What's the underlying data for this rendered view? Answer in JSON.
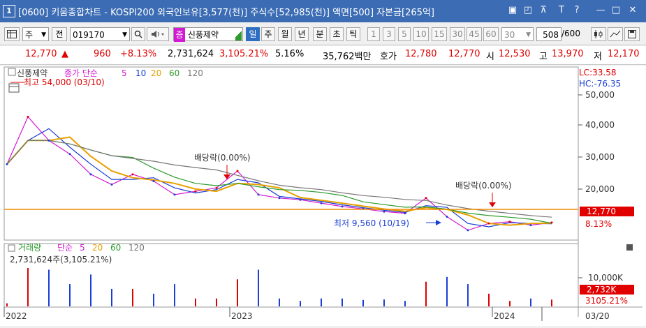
{
  "window": {
    "number": "1",
    "title": "[0600] 키움종합차트 - KOSPI200 외국인보유[3,577(천)] 주식수[52,985(천)] 액면[500] 자본금[265억]",
    "buttons": [
      "▣",
      "◰",
      "⊼",
      "T",
      "?",
      "—",
      "□",
      "✕"
    ]
  },
  "toolbar": {
    "market_type": "주",
    "period_label": "전",
    "stock_code": "019170",
    "stock_badge": "증",
    "stock_name": "신풍제약",
    "period_tabs": [
      "일",
      "주",
      "월",
      "년"
    ],
    "period_selected": "일",
    "interval_tabs": [
      "분",
      "초",
      "틱"
    ],
    "minute_values": [
      "1",
      "3",
      "5",
      "10",
      "15",
      "30",
      "45",
      "60"
    ],
    "interval_select": "30",
    "count_current": "508",
    "count_total": "/600"
  },
  "quote": {
    "price": "12,770",
    "change_arrow": "▲",
    "change": "960",
    "change_pct": "+8.13%",
    "volume": "2,731,624",
    "volume_ratio": "3,105.21%",
    "turnover": "5.16%",
    "amount": "35,762백만",
    "bid_label": "호가",
    "ask": "12,780",
    "bid": "12,770",
    "open_label": "시",
    "open": "12,530",
    "high_label": "고",
    "high": "13,970",
    "low_label": "저",
    "low": "12,170"
  },
  "price_panel": {
    "name": "신풍제약",
    "ma_title": "종가 단순",
    "ma_periods": [
      "5",
      "10",
      "20",
      "60",
      "120"
    ],
    "ma_colors": [
      "#d21ad2",
      "#1a3fd6",
      "#e8a000",
      "#2c9a2c",
      "#777777"
    ],
    "lc": "LC:33.58",
    "hc": "HC:-76.35",
    "y_ticks": [
      "50,000",
      "40,000",
      "30,000",
      "20,000"
    ],
    "high_note": "최고 54,000 (03/10)",
    "low_note": "최저 9,560 (10/19)",
    "dividend_note_1": "배당락(0.00%)",
    "dividend_note_2": "배당락(0.00%)",
    "current_price_tag": "12,770",
    "current_pct_tag": "8.13%"
  },
  "volume_panel": {
    "title": "거래량",
    "ma_title": "단순",
    "ma_periods": [
      "5",
      "20",
      "60",
      "120"
    ],
    "ma_colors": [
      "#d21ad2",
      "#e8a000",
      "#2c9a2c",
      "#777777"
    ],
    "last_volume": "2,731,624주(3,105.21%)",
    "y_tick": "10,000K",
    "volume_tag": "2,732K",
    "ratio_tag": "3105.21%"
  },
  "x_axis": {
    "labels": [
      "2022",
      "2023",
      "2024"
    ],
    "last_date": "03/20"
  },
  "chart_data": {
    "type": "line",
    "title": "신풍제약",
    "x": [
      "2022-01",
      "2022-02",
      "2022-03",
      "2022-04",
      "2022-05",
      "2022-06",
      "2022-07",
      "2022-08",
      "2022-09",
      "2022-10",
      "2022-11",
      "2022-12",
      "2023-01",
      "2023-02",
      "2023-03",
      "2023-04",
      "2023-05",
      "2023-06",
      "2023-07",
      "2023-08",
      "2023-09",
      "2023-10",
      "2023-11",
      "2023-12",
      "2024-01",
      "2024-02",
      "2024-03"
    ],
    "series": [
      {
        "name": "종가",
        "values": [
          30000,
          44000,
          37000,
          33000,
          27000,
          24000,
          27000,
          25000,
          21000,
          22000,
          23000,
          28000,
          21000,
          20000,
          19500,
          18500,
          17500,
          16800,
          16000,
          15500,
          20000,
          14500,
          10500,
          12500,
          13000,
          12000,
          12770
        ]
      }
    ],
    "ylim": [
      8000,
      55000
    ],
    "volume_ylim": [
      0,
      12000
    ]
  }
}
